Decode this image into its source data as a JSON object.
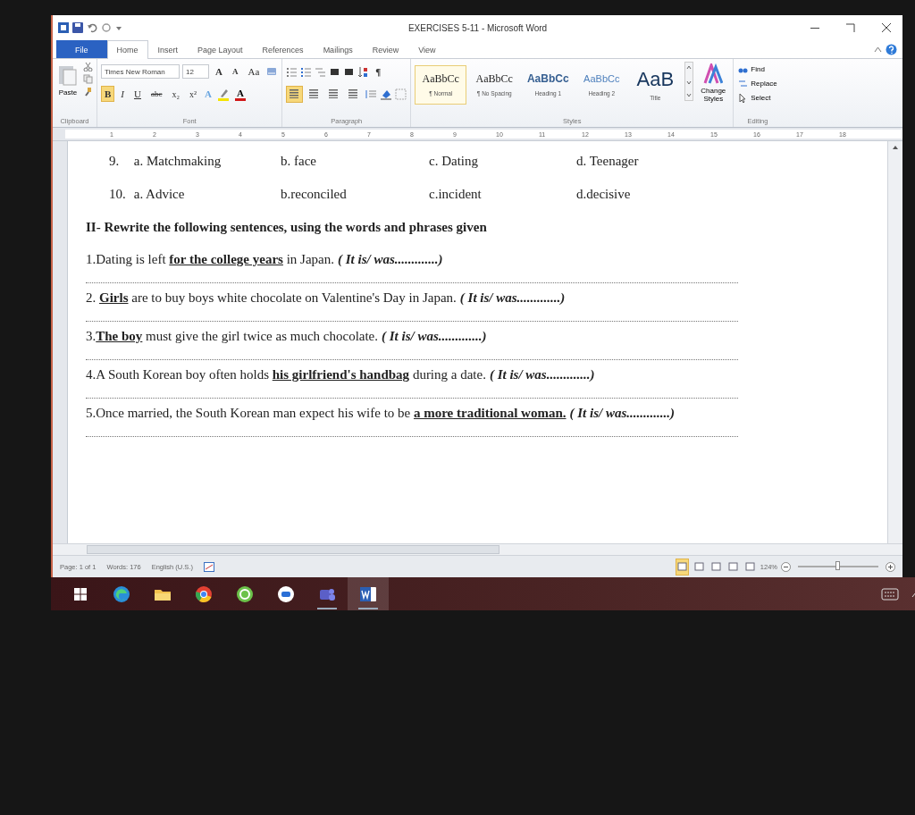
{
  "window": {
    "title": "EXERCISES 5-11 - Microsoft Word"
  },
  "tabs": [
    {
      "label": "File",
      "kind": "file",
      "selected": false
    },
    {
      "label": "Home",
      "kind": "tab",
      "selected": true
    },
    {
      "label": "Insert",
      "kind": "tab",
      "selected": false
    },
    {
      "label": "Page Layout",
      "kind": "tab",
      "selected": false
    },
    {
      "label": "References",
      "kind": "tab",
      "selected": false
    },
    {
      "label": "Mailings",
      "kind": "tab",
      "selected": false
    },
    {
      "label": "Review",
      "kind": "tab",
      "selected": false
    },
    {
      "label": "View",
      "kind": "tab",
      "selected": false
    }
  ],
  "ribbon": {
    "clipboard": {
      "paste": "Paste",
      "label": "Clipboard"
    },
    "font": {
      "name": "Times New Roman",
      "size": "12",
      "grow": "A",
      "shrink": "A",
      "case": "Aa",
      "label": "Font",
      "format_buttons": [
        {
          "label": "B",
          "selected": true
        },
        {
          "label": "I",
          "selected": false
        },
        {
          "label": "U",
          "selected": false
        },
        {
          "label": "abc",
          "selected": false
        },
        {
          "label": "x₂",
          "selected": false
        },
        {
          "label": "x²",
          "selected": false
        }
      ],
      "color_buttons": [
        {
          "kind": "effect",
          "label": "A",
          "color": "#6aa6e0"
        },
        {
          "kind": "highlight",
          "color": "#f5e400"
        },
        {
          "kind": "font",
          "label": "A",
          "color": "#d01818"
        }
      ]
    },
    "paragraph": {
      "pilcrow": "¶",
      "label": "Paragraph",
      "align_buttons": [
        {
          "selected": true
        },
        {
          "selected": false
        },
        {
          "selected": false
        },
        {
          "selected": false
        }
      ]
    },
    "styles": {
      "label": "Styles",
      "items": [
        {
          "sample": "AaBbCc",
          "name": "¶ Normal",
          "kind": "normal",
          "selected": true
        },
        {
          "sample": "AaBbCc",
          "name": "¶ No Spacing",
          "kind": "normal",
          "selected": false
        },
        {
          "sample": "AaBbCc",
          "name": "Heading 1",
          "kind": "heading1",
          "selected": false
        },
        {
          "sample": "AaBbCc",
          "name": "Heading 2",
          "kind": "heading2",
          "selected": false
        },
        {
          "sample": "AaB",
          "name": "Title",
          "kind": "title",
          "selected": false
        }
      ]
    },
    "change_styles": "Change Styles",
    "editing": {
      "label": "Editing",
      "items": [
        "Find",
        "Replace",
        "Select"
      ]
    }
  },
  "ruler": {
    "marks": [
      "1",
      "2",
      "3",
      "4",
      "5",
      "6",
      "7",
      "8",
      "9",
      "10",
      "11",
      "12",
      "13",
      "14",
      "15",
      "16",
      "17",
      "18"
    ]
  },
  "document": {
    "option_rows": [
      {
        "number": "9.",
        "options": [
          "a. Matchmaking",
          "b. face",
          "c. Dating",
          "d. Teenager"
        ]
      },
      {
        "number": "10.",
        "options": [
          "a. Advice",
          "b.reconciled",
          "c.incident",
          "d.decisive"
        ]
      }
    ],
    "heading": "II- Rewrite the following sentences, using the words and phrases given",
    "sentences": [
      {
        "text": "1.Dating is left **for the college years** in Japan.",
        "hint": "( It is/ was.............)"
      },
      {
        "text": "2. **Girls** are to buy boys white chocolate on Valentine's Day in Japan.",
        "hint": "( It is/ was.............)"
      },
      {
        "text": "3.**The boy** must give the girl twice as much chocolate.",
        "hint": "( It is/ was.............)"
      },
      {
        "text": "4.A South Korean boy often holds **his girlfriend's handbag** during a date.",
        "hint": "( It is/ was.............)"
      },
      {
        "text": "5.Once married, the South Korean man expect his wife  to be **a more traditional  woman.**",
        "hint": "( It is/ was.............)"
      }
    ]
  },
  "status_bar": {
    "page": "Page: 1 of 1",
    "words": "Words: 176",
    "language": "English (U.S.)",
    "views": [
      {
        "selected": true
      },
      {
        "selected": false
      },
      {
        "selected": false
      },
      {
        "selected": false
      },
      {
        "selected": false
      }
    ],
    "zoom": {
      "reading": "124%",
      "level": 0.5
    }
  },
  "taskbar": {
    "items": [
      {
        "kind": "start",
        "selected": false,
        "running": false
      },
      {
        "kind": "edge",
        "selected": false,
        "running": false
      },
      {
        "kind": "folder",
        "selected": false,
        "running": false
      },
      {
        "kind": "chrome",
        "selected": false,
        "running": false
      },
      {
        "kind": "green",
        "selected": false,
        "running": false
      },
      {
        "kind": "chat",
        "selected": false,
        "running": false
      },
      {
        "kind": "teams",
        "selected": false,
        "running": true
      },
      {
        "kind": "word",
        "selected": true,
        "running": true
      }
    ]
  }
}
